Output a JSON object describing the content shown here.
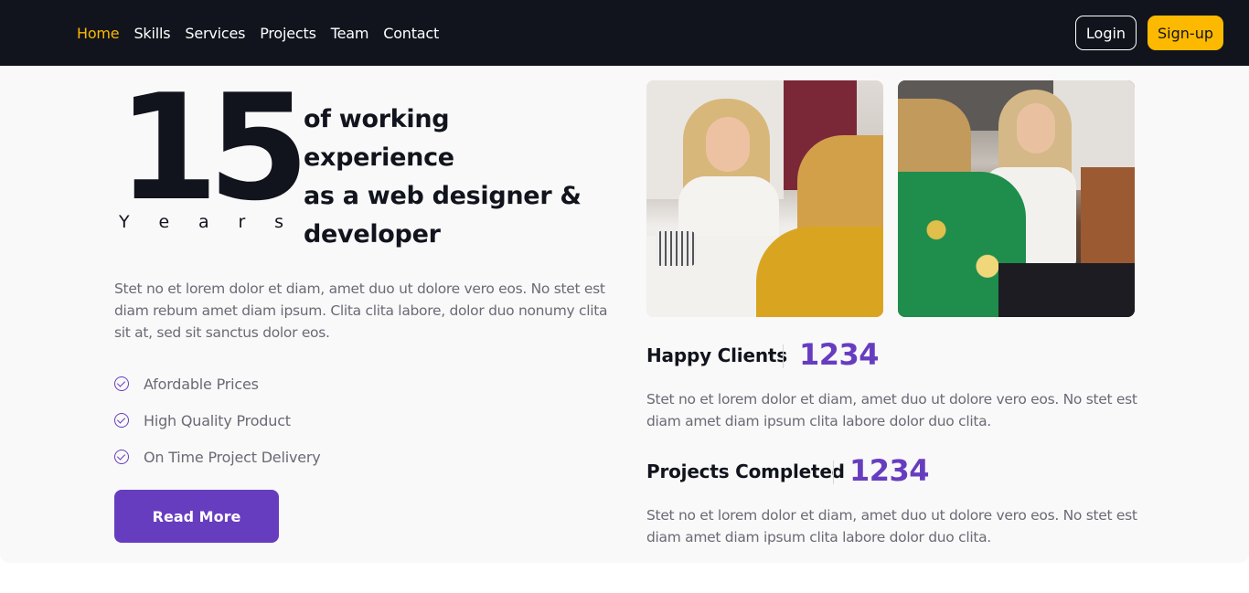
{
  "nav": {
    "links": [
      {
        "label": "Home",
        "active": true
      },
      {
        "label": "Skills",
        "active": false
      },
      {
        "label": "Services",
        "active": false
      },
      {
        "label": "Projects",
        "active": false
      },
      {
        "label": "Team",
        "active": false
      },
      {
        "label": "Contact",
        "active": false
      }
    ],
    "login_label": "Login",
    "signup_label": "Sign-up"
  },
  "about": {
    "years_number": "15",
    "years_letters": [
      "Y",
      "e",
      "a",
      "r",
      "s"
    ],
    "experience_line1": "of working experience",
    "experience_line2": "as a web designer &",
    "experience_line3": "developer",
    "description": "Stet no et lorem dolor et diam, amet duo ut dolore vero eos. No stet est diam rebum amet diam ipsum. Clita clita labore, dolor duo nonumy clita sit at, sed sit sanctus dolor eos.",
    "features": [
      "Afordable Prices",
      "High Quality Product",
      "On Time Project Delivery"
    ],
    "read_more_label": "Read More"
  },
  "stats": [
    {
      "label": "Happy Clients",
      "value": "1234",
      "description": "Stet no et lorem dolor et diam, amet duo ut dolore vero eos. No stet est diam amet diam ipsum clita labore dolor duo clita."
    },
    {
      "label": "Projects Completed",
      "value": "1234",
      "description": "Stet no et lorem dolor et diam, amet duo ut dolore vero eos. No stet est diam amet diam ipsum clita labore dolor duo clita."
    }
  ],
  "colors": {
    "navbar_bg": "#11141c",
    "accent_yellow": "#fcb900",
    "accent_purple": "#673dc0",
    "section_bg": "#f9f9f9",
    "body_text": "#6b6a75"
  }
}
